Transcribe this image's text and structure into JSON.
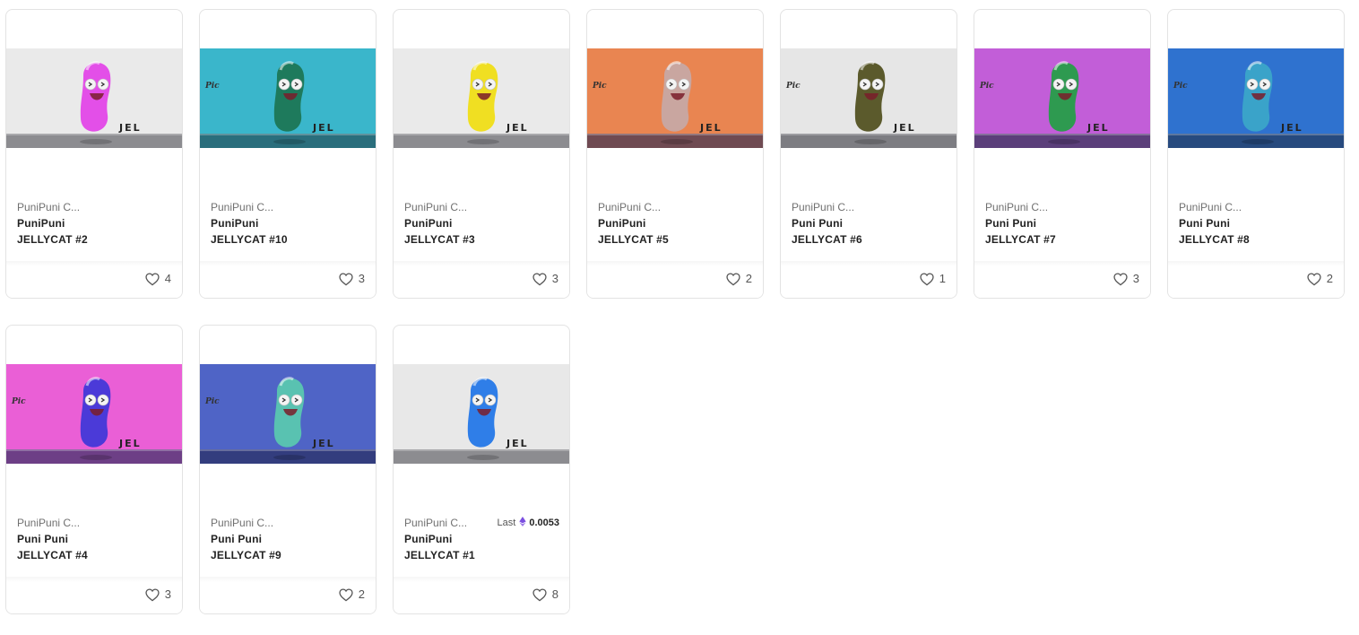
{
  "colors": {
    "card_border": "#e3e3e3",
    "heart_stroke": "#555555",
    "eth_purple": "#7b4fe0"
  },
  "cards": [
    {
      "collection": "PuniPuni C...",
      "name_line1": "PuniPuni",
      "name_line2": "JELLYCAT #2",
      "likes": "4",
      "bg": "#eaeaea",
      "floor": "#8c8c90",
      "jelly": "#e34fe8",
      "logo": false,
      "last_label": "",
      "last_price": ""
    },
    {
      "collection": "PuniPuni C...",
      "name_line1": "PuniPuni",
      "name_line2": "JELLYCAT #10",
      "likes": "3",
      "bg": "#3ab6cb",
      "floor": "#2a6e7c",
      "jelly": "#1e7a5c",
      "logo": true,
      "last_label": "",
      "last_price": ""
    },
    {
      "collection": "PuniPuni C...",
      "name_line1": "PuniPuni",
      "name_line2": "JELLYCAT #3",
      "likes": "3",
      "bg": "#eaeaea",
      "floor": "#8c8c90",
      "jelly": "#f0df22",
      "logo": false,
      "last_label": "",
      "last_price": ""
    },
    {
      "collection": "PuniPuni C...",
      "name_line1": "PuniPuni",
      "name_line2": "JELLYCAT #5",
      "likes": "2",
      "bg": "#e98551",
      "floor": "#6f4a52",
      "jelly": "#c9a6a0",
      "logo": true,
      "last_label": "",
      "last_price": ""
    },
    {
      "collection": "PuniPuni C...",
      "name_line1": "Puni Puni",
      "name_line2": "JELLYCAT #6",
      "likes": "1",
      "bg": "#e6e6e6",
      "floor": "#7d7d82",
      "jelly": "#5b5a2c",
      "logo": true,
      "last_label": "",
      "last_price": ""
    },
    {
      "collection": "PuniPuni C...",
      "name_line1": "Puni Puni",
      "name_line2": "JELLYCAT #7",
      "likes": "3",
      "bg": "#c25ed8",
      "floor": "#5b3f7a",
      "jelly": "#2e9a50",
      "logo": true,
      "last_label": "",
      "last_price": ""
    },
    {
      "collection": "PuniPuni C...",
      "name_line1": "Puni Puni",
      "name_line2": "JELLYCAT #8",
      "likes": "2",
      "bg": "#2f72cf",
      "floor": "#274a7e",
      "jelly": "#3aa3c9",
      "logo": true,
      "last_label": "",
      "last_price": ""
    },
    {
      "collection": "PuniPuni C...",
      "name_line1": "Puni Puni",
      "name_line2": "JELLYCAT #4",
      "likes": "3",
      "bg": "#ea5fd6",
      "floor": "#6d3f86",
      "jelly": "#4b3ad8",
      "logo": true,
      "last_label": "",
      "last_price": ""
    },
    {
      "collection": "PuniPuni C...",
      "name_line1": "Puni Puni",
      "name_line2": "JELLYCAT #9",
      "likes": "2",
      "bg": "#4f64c6",
      "floor": "#333d7e",
      "jelly": "#59c2b1",
      "logo": true,
      "last_label": "",
      "last_price": ""
    },
    {
      "collection": "PuniPuni C...",
      "name_line1": "PuniPuni",
      "name_line2": "JELLYCAT #1",
      "likes": "8",
      "bg": "#e8e8e8",
      "floor": "#8c8c90",
      "jelly": "#2f7ee8",
      "logo": false,
      "last_label": "Last",
      "last_price": "0.0053"
    }
  ]
}
